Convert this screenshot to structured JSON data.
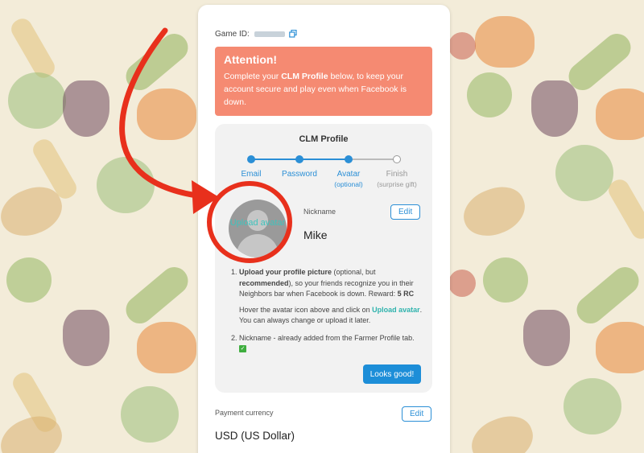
{
  "game_id": {
    "label": "Game ID:",
    "copy_icon": "copy-icon"
  },
  "attention": {
    "title": "Attention!",
    "body_prefix": "Complete your ",
    "body_bold": "CLM Profile",
    "body_suffix": " below, to keep your account secure and play even when Facebook is down."
  },
  "profile": {
    "title": "CLM Profile",
    "steps": [
      {
        "label": "Email",
        "sub": "",
        "state": "done"
      },
      {
        "label": "Password",
        "sub": "",
        "state": "done"
      },
      {
        "label": "Avatar",
        "sub": "(optional)",
        "state": "current"
      },
      {
        "label": "Finish",
        "sub": "(surprise gift)",
        "state": "pending"
      }
    ],
    "upload_avatar": "Upload avatar",
    "nickname_label": "Nickname",
    "nickname_value": "Mike",
    "edit_label": "Edit",
    "instructions": {
      "item1_bold": "Upload your profile picture",
      "item1_a": " (optional, but ",
      "item1_bold2": "recommended",
      "item1_b": "), so your friends recognize you in their Neighbors bar when Facebook is down. Reward: ",
      "item1_reward": "5 RC",
      "item1_hover_a": "Hover the avatar icon above and click on ",
      "item1_hover_link": "Upload avatar",
      "item1_hover_b": ". You can always change or upload it later.",
      "item2": "Nickname - already added from the Farmer Profile tab. "
    },
    "looks_good": "Looks good!"
  },
  "payment": {
    "label": "Payment currency",
    "edit_label": "Edit",
    "value": "USD (US Dollar)"
  },
  "colors": {
    "attention_bg": "#f58a72",
    "primary_blue": "#1d8ed8",
    "teal_link": "#2fb3ad",
    "annotation_red": "#e8301c"
  }
}
